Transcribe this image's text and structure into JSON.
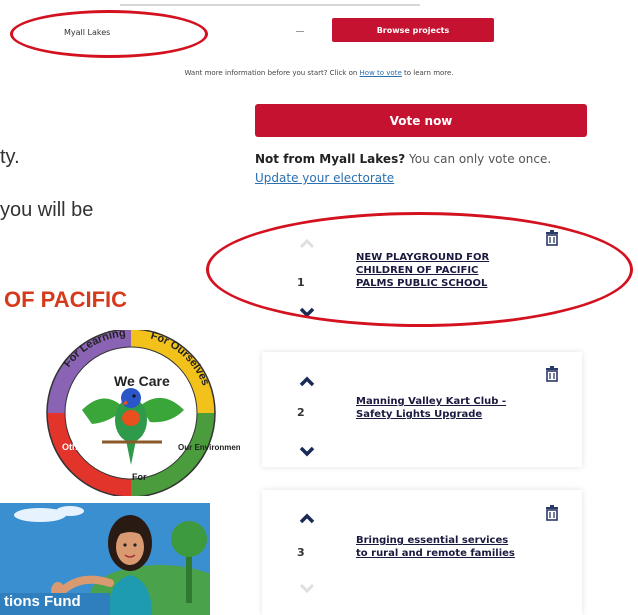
{
  "top": {
    "electorate_value": "Myall Lakes",
    "browse_label": "Browse projects",
    "info_prefix": "Want more information before you start? Click on ",
    "info_link": "How to vote",
    "info_suffix": " to learn more."
  },
  "left": {
    "fragment_1": "ty.",
    "fragment_2": "you will be",
    "school_title": "OF PACIFIC",
    "badge": {
      "top_left": "For Learning",
      "top_right": "For Ourselves",
      "center": "We Care",
      "right": "Our Environment",
      "bottom": "For",
      "left": "Others"
    },
    "banner_text": "tions Fund"
  },
  "right": {
    "vote_label": "Vote now",
    "notice_bold": "Not from Myall Lakes?",
    "notice_text": " You can only vote once. ",
    "notice_link": "Update your electorate"
  },
  "projects": [
    {
      "rank": "1",
      "title": "NEW PLAYGROUND FOR CHILDREN OF PACIFIC PALMS PUBLIC SCHOOL"
    },
    {
      "rank": "2",
      "title": "Manning Valley Kart Club - Safety Lights Upgrade"
    },
    {
      "rank": "3",
      "title": "Bringing essential services to rural and remote families"
    }
  ],
  "colors": {
    "brand_red": "#c41230",
    "annotation_red": "#d3111f",
    "link_blue": "#2a6fb0",
    "school_orange": "#d63a1c"
  },
  "icons": [
    "trash-icon",
    "chevron-up-icon",
    "chevron-down-icon"
  ]
}
